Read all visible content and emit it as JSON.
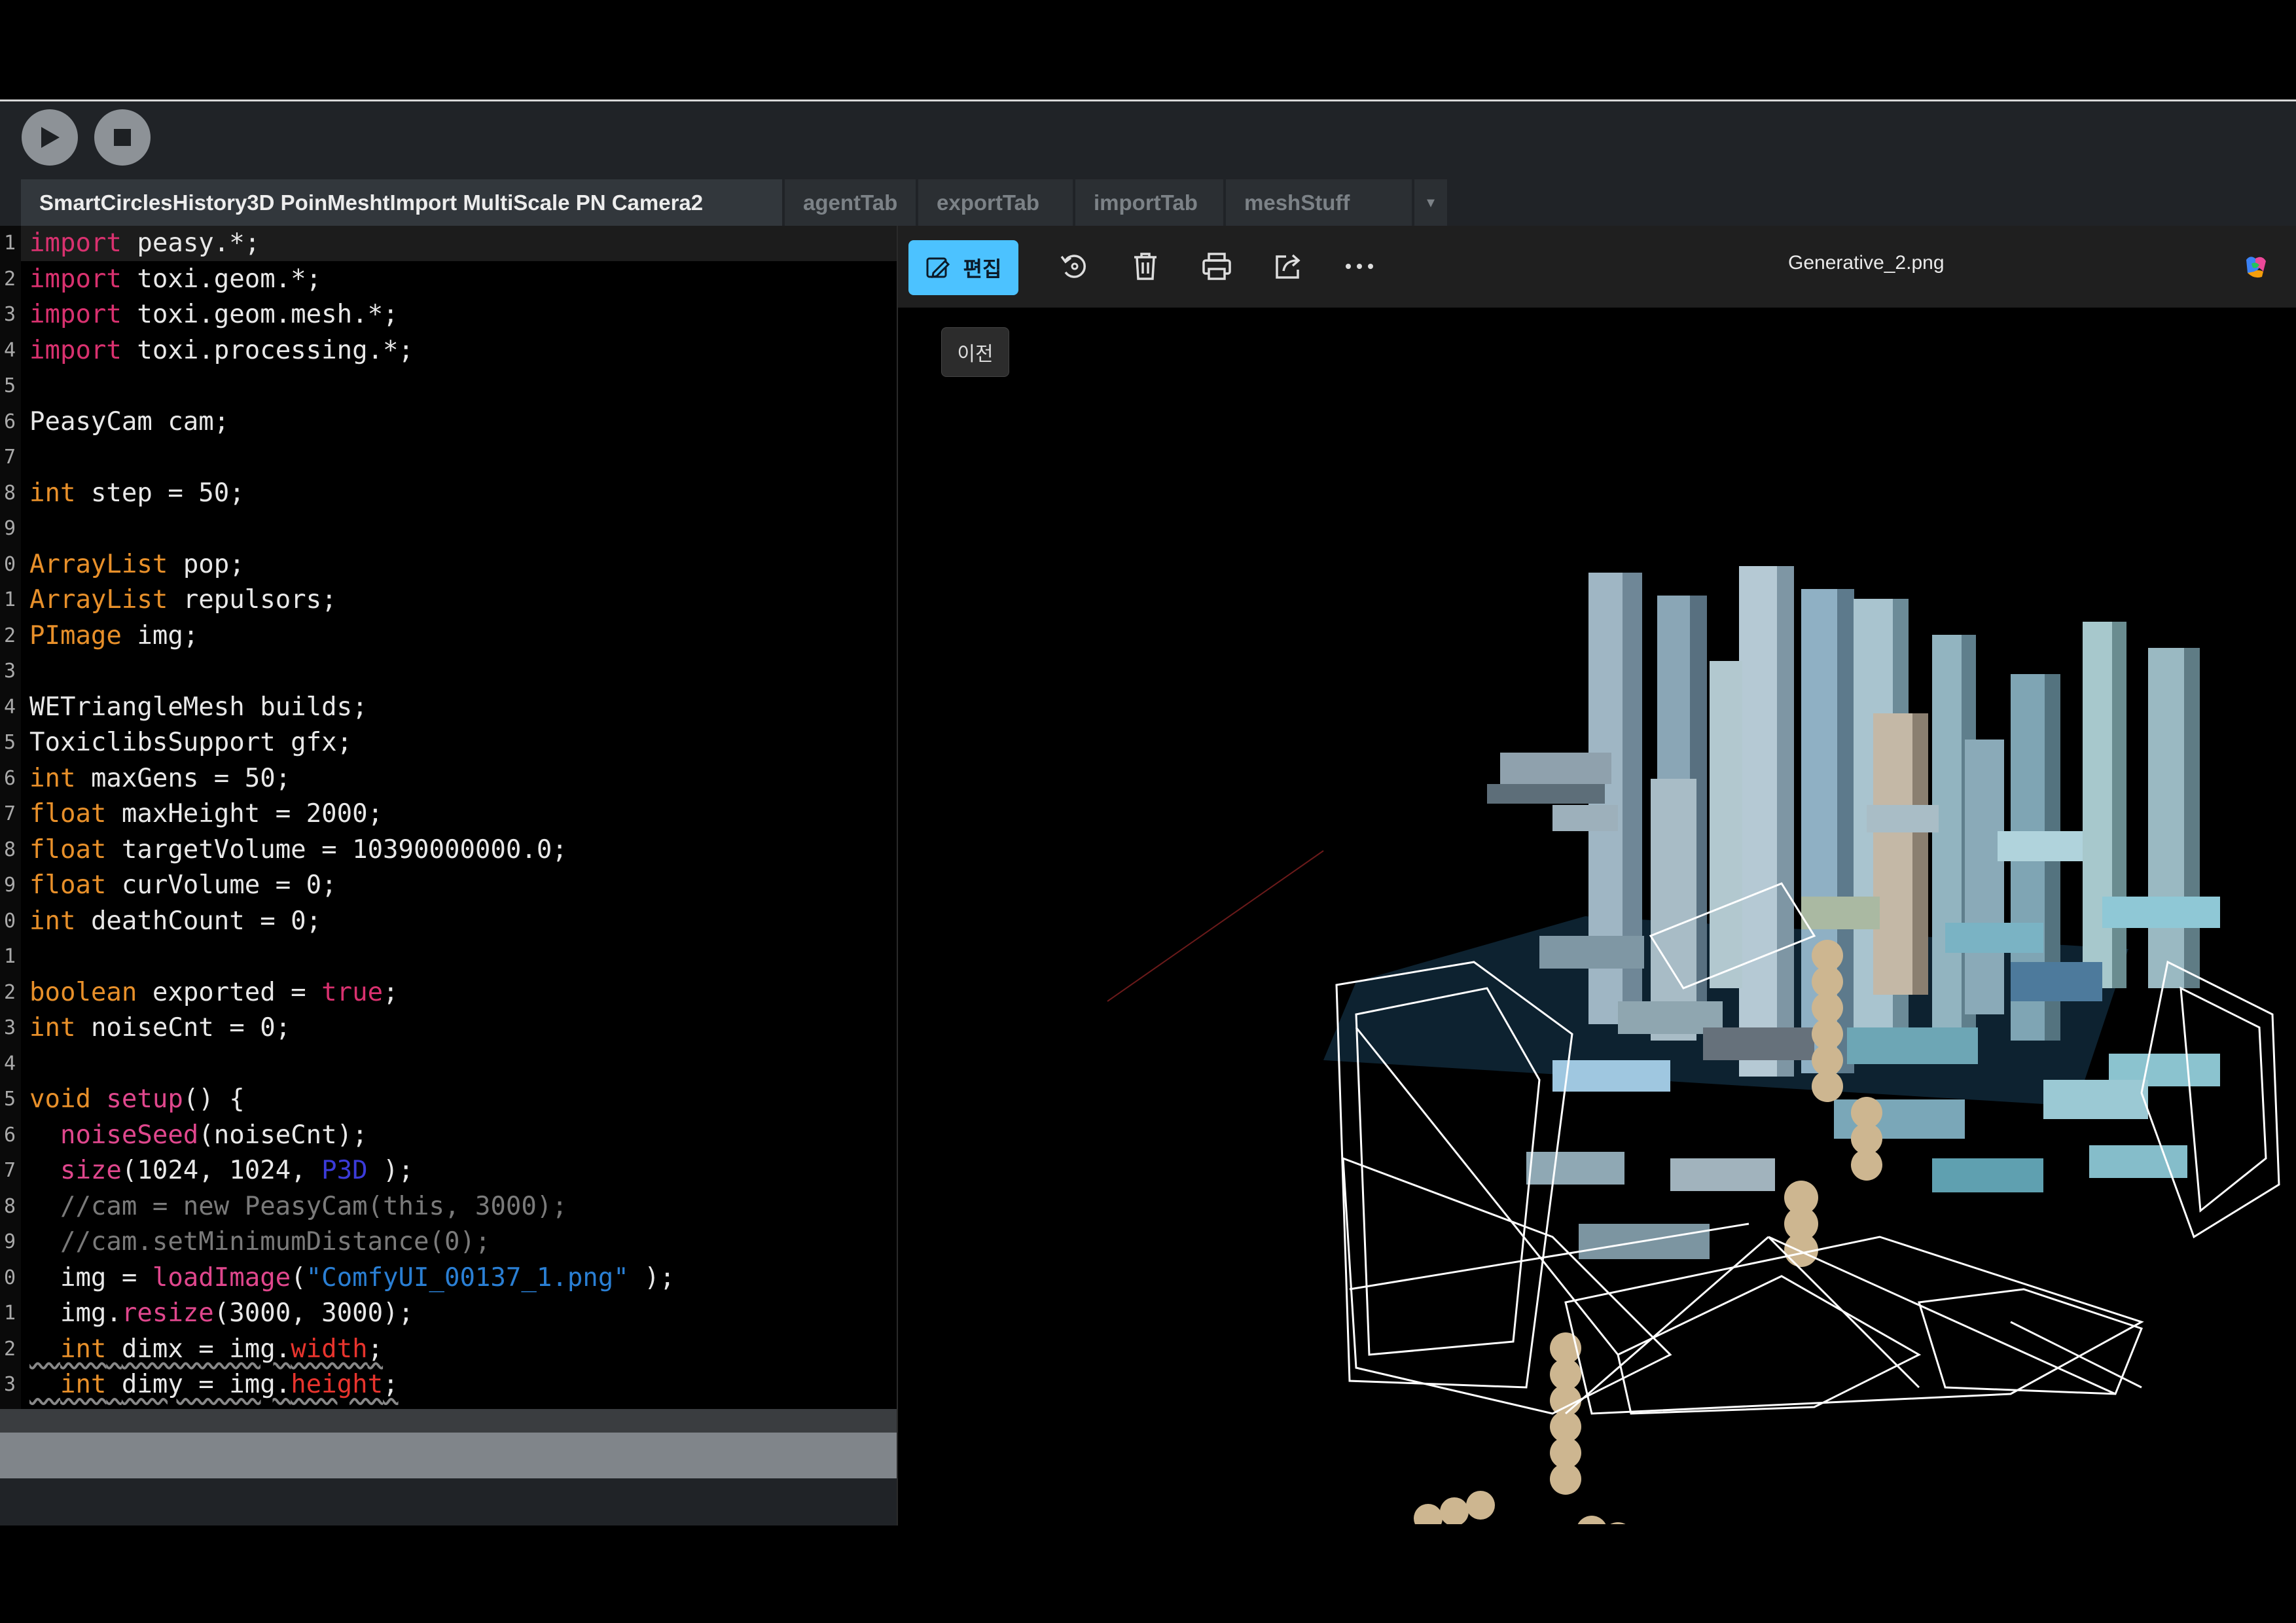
{
  "toolbar": {
    "run": "play-icon",
    "stop": "stop-icon"
  },
  "tabs": [
    {
      "label": "SmartCirclesHistory3D PoinMeshtImport MultiScale PN Camera2",
      "active": true
    },
    {
      "label": "agentTab"
    },
    {
      "label": "exportTab"
    },
    {
      "label": "importTab"
    },
    {
      "label": "meshStuff"
    }
  ],
  "tabs_more": "▾",
  "code": [
    {
      "n": "1"
    },
    {
      "n": "2"
    },
    {
      "n": "3"
    },
    {
      "n": "4"
    },
    {
      "n": "5"
    },
    {
      "n": "6"
    },
    {
      "n": "7"
    },
    {
      "n": "8"
    },
    {
      "n": "9"
    },
    {
      "n": "0"
    },
    {
      "n": "1"
    },
    {
      "n": "2"
    },
    {
      "n": "3"
    },
    {
      "n": "4"
    },
    {
      "n": "5"
    },
    {
      "n": "6"
    },
    {
      "n": "7"
    },
    {
      "n": "8"
    },
    {
      "n": "9"
    },
    {
      "n": "0"
    },
    {
      "n": "1"
    },
    {
      "n": "2"
    },
    {
      "n": "3"
    },
    {
      "n": "4"
    },
    {
      "n": "5"
    },
    {
      "n": "6"
    },
    {
      "n": "7"
    },
    {
      "n": "8"
    },
    {
      "n": "9"
    },
    {
      "n": "0"
    },
    {
      "n": "1"
    },
    {
      "n": "2"
    },
    {
      "n": "3"
    }
  ],
  "code_text": [
    [
      [
        "kw",
        "import"
      ],
      [
        "",
        "peasy.*;"
      ]
    ],
    [
      [
        "kw",
        "import"
      ],
      [
        "",
        "toxi.geom.*;"
      ]
    ],
    [
      [
        "kw",
        "import"
      ],
      [
        "",
        "toxi.geom.mesh.*;"
      ]
    ],
    [
      [
        "kw",
        "import"
      ],
      [
        "",
        "toxi.processing.*;"
      ]
    ],
    [],
    [
      [
        "",
        "PeasyCam cam;"
      ]
    ],
    [],
    [
      [
        "ty",
        "int"
      ],
      [
        "",
        "step = 50;"
      ]
    ],
    [],
    [
      [
        "ty",
        "ArrayList"
      ],
      [
        "",
        "pop;"
      ]
    ],
    [
      [
        "ty",
        "ArrayList"
      ],
      [
        "",
        "repulsors;"
      ]
    ],
    [
      [
        "ty",
        "PImage"
      ],
      [
        "",
        "img;"
      ]
    ],
    [],
    [
      [
        "",
        "WETriangleMesh builds;"
      ]
    ],
    [
      [
        "",
        "ToxiclibsSupport gfx;"
      ]
    ],
    [
      [
        "ty",
        "int"
      ],
      [
        "",
        "maxGens = 50;"
      ]
    ],
    [
      [
        "ty",
        "float"
      ],
      [
        "",
        "maxHeight = 2000;"
      ]
    ],
    [
      [
        "ty",
        "float"
      ],
      [
        "",
        "targetVolume = 10390000000.0;"
      ]
    ],
    [
      [
        "ty",
        "float"
      ],
      [
        "",
        "curVolume = 0;"
      ]
    ],
    [
      [
        "ty",
        "int"
      ],
      [
        "",
        "deathCount = 0;"
      ]
    ],
    [],
    [
      [
        "ty",
        "boolean"
      ],
      [
        "",
        "exported = "
      ],
      [
        "kw",
        "true"
      ],
      [
        "",
        ";"
      ]
    ],
    [
      [
        "ty",
        "int"
      ],
      [
        "",
        "noiseCnt = 0;"
      ]
    ],
    [],
    [
      [
        "ty",
        "void"
      ],
      [
        "fn",
        " setup"
      ],
      [
        "",
        "() {"
      ]
    ],
    [
      [
        "",
        "  "
      ],
      [
        "fn",
        "noiseSeed"
      ],
      [
        "",
        "(noiseCnt);"
      ]
    ],
    [
      [
        "",
        "  "
      ],
      [
        "fn",
        "size"
      ],
      [
        "",
        "(1024, 1024, "
      ],
      [
        "cst",
        "P3D"
      ],
      [
        "",
        ");"
      ]
    ],
    [
      [
        "cm",
        "  //cam = new PeasyCam(this, 3000);"
      ]
    ],
    [
      [
        "cm",
        "  //cam.setMinimumDistance(0);"
      ]
    ],
    [
      [
        "",
        "  img = "
      ],
      [
        "fn",
        "loadImage"
      ],
      [
        "",
        "("
      ],
      [
        "str",
        "\"ComfyUI_00137_1.png\""
      ],
      [
        "",
        ");"
      ]
    ],
    [
      [
        "",
        "  img."
      ],
      [
        "fn",
        "resize"
      ],
      [
        "",
        "(3000, 3000);"
      ]
    ],
    [
      [
        "",
        "  "
      ],
      [
        "ty",
        "int"
      ],
      [
        "",
        "dimx = img."
      ],
      [
        "fld",
        "width"
      ],
      [
        "",
        ";"
      ]
    ],
    [
      [
        "",
        "  "
      ],
      [
        "ty",
        "int"
      ],
      [
        "",
        "dimy = img."
      ],
      [
        "fld",
        "height"
      ],
      [
        "",
        ";"
      ]
    ]
  ],
  "viewer": {
    "edit_label": "편집",
    "edit_icon": "edit-image-icon",
    "icons": [
      "rotate-icon",
      "delete-icon",
      "print-icon",
      "share-icon",
      "more-icon"
    ],
    "file_name": "Generative_2.png",
    "tooltip": "이전",
    "copilot": "copilot-icon"
  },
  "colors": {
    "accent": "#4cc2ff",
    "tab_active_bg": "#32373c",
    "toolbar_bg": "#202327"
  }
}
